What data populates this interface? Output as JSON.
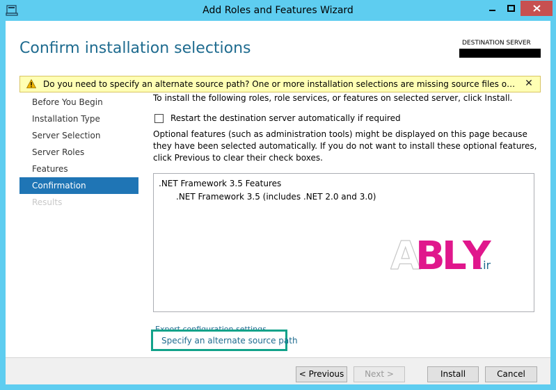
{
  "window": {
    "title": "Add Roles and Features Wizard"
  },
  "header": {
    "page_title": "Confirm installation selections",
    "destination_label": "DESTINATION SERVER"
  },
  "warning": {
    "text": "Do you need to specify an alternate source path? One or more installation selections are missing source files on the destination server.",
    "close": "✕"
  },
  "nav": {
    "items": [
      {
        "label": "Before You Begin"
      },
      {
        "label": "Installation Type"
      },
      {
        "label": "Server Selection"
      },
      {
        "label": "Server Roles"
      },
      {
        "label": "Features"
      },
      {
        "label": "Confirmation"
      },
      {
        "label": "Results"
      }
    ],
    "active": "Confirmation"
  },
  "main": {
    "intro": "To install the following roles, role services, or features on selected server, click Install.",
    "restart_label": "Restart the destination server automatically if required",
    "optional_text": "Optional features (such as administration tools) might be displayed on this page because they have been selected automatically. If you do not want to install these optional features, click Previous to clear their check boxes.",
    "selections": [
      ".NET Framework 3.5 Features",
      ".NET Framework 3.5 (includes .NET 2.0 and 3.0)"
    ],
    "export_link": "Export configuration settings",
    "alt_source_link": "Specify an alternate source path"
  },
  "watermark": {
    "text": "ABLY",
    "suffix": ".ir",
    "colors": {
      "a": "#ffffff",
      "b": "#e0178c",
      "l": "#e0178c",
      "y": "#e0178c"
    }
  },
  "footer": {
    "previous": "< Previous",
    "next": "Next >",
    "install": "Install",
    "cancel": "Cancel"
  },
  "colors": {
    "chrome": "#5ecdf0",
    "title_blue": "#1e6b8f",
    "nav_active": "#1f75b5",
    "highlight_border": "#12a28a",
    "warning_bg": "#ffffb4"
  }
}
